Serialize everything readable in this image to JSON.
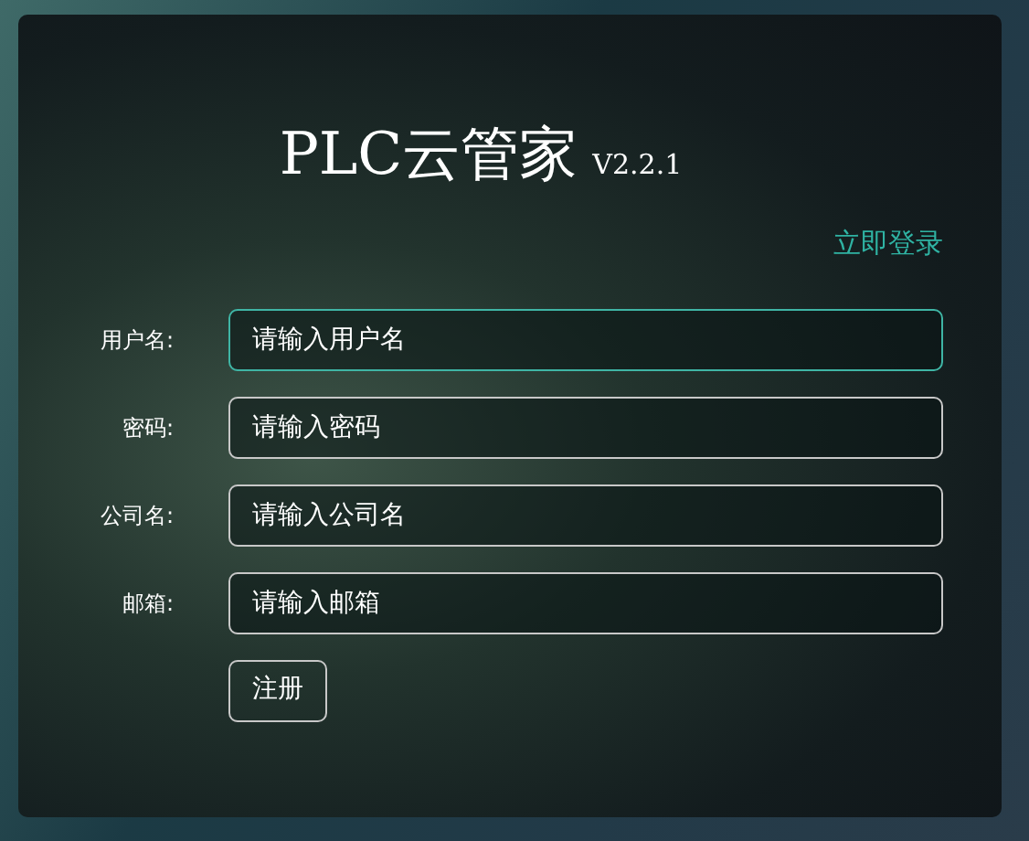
{
  "title": "PLC云管家",
  "version": "V2.2.1",
  "login_link": "立即登录",
  "fields": [
    {
      "label": "用户名:",
      "placeholder": "请输入用户名",
      "focused": true
    },
    {
      "label": "密码:",
      "placeholder": "请输入密码",
      "focused": false
    },
    {
      "label": "公司名:",
      "placeholder": "请输入公司名",
      "focused": false
    },
    {
      "label": "邮箱:",
      "placeholder": "请输入邮箱",
      "focused": false
    }
  ],
  "buttons": [
    "注册"
  ]
}
